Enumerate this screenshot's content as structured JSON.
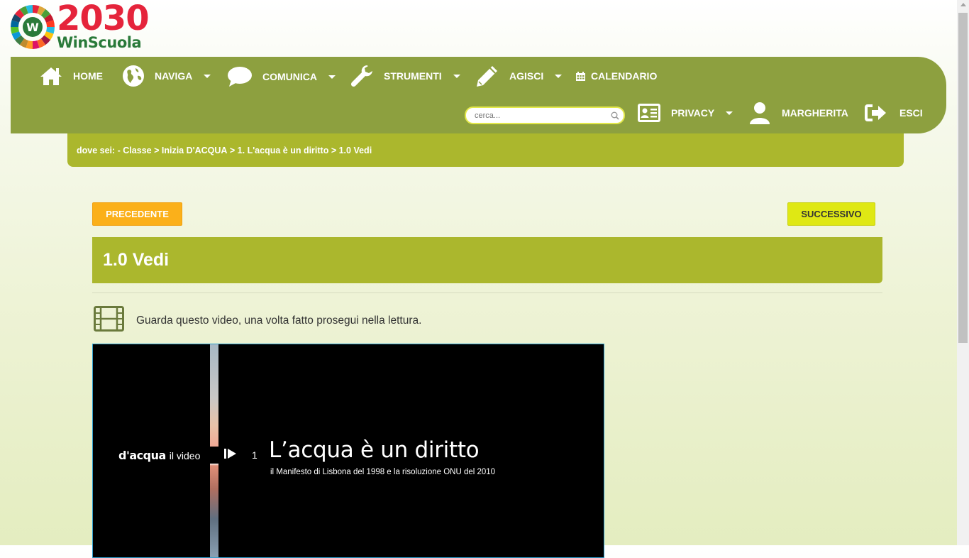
{
  "logo": {
    "year": "2030",
    "name": "WinScuola",
    "wheel_letter": "W"
  },
  "nav": {
    "home": "HOME",
    "naviga": "NAVIGA",
    "comunica": "COMUNICA",
    "strumenti": "STRUMENTI",
    "agisci": "AGISCI",
    "calendario": "CALENDARIO",
    "search_placeholder": "cerca...",
    "privacy": "PRIVACY",
    "user": "MARGHERITA",
    "logout": "ESCI"
  },
  "breadcrumb": {
    "prefix": "dove sei: - ",
    "items": [
      "Classe",
      "Inizia D'ACQUA",
      "1. L'acqua è un diritto"
    ],
    "separator": " > ",
    "current": "1.0 Vedi"
  },
  "buttons": {
    "prev": "PRECEDENTE",
    "next": "SUCCESSIVO"
  },
  "page": {
    "title": "1.0 Vedi",
    "instruction": "Guarda questo video, una volta fatto prosegui nella lettura."
  },
  "video": {
    "brand": "d'acqua",
    "brand_suffix": "il video",
    "number": "1",
    "title": "L’acqua è un diritto",
    "subtitle": "il Manifesto di Lisbona del 1998 e la risoluzione ONU del 2010"
  },
  "colors": {
    "nav_bg": "#8da03f",
    "breadcrumb_bg": "#abb72d",
    "prev_btn": "#fbb01a",
    "next_btn": "#dfe814"
  }
}
